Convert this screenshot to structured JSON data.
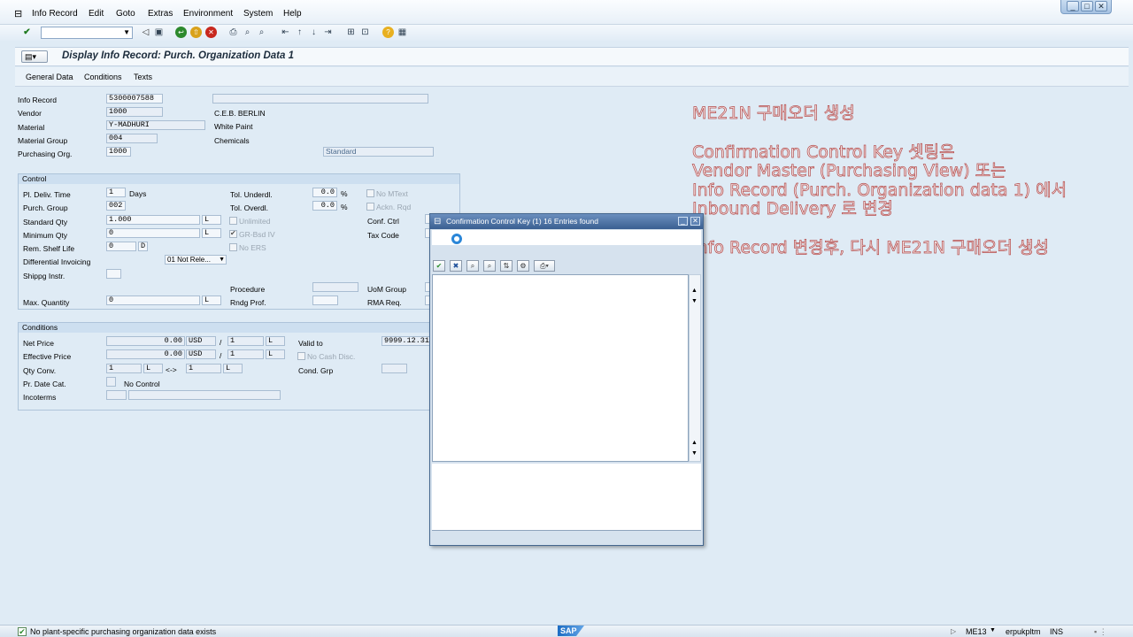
{
  "menu": {
    "items": [
      "Info Record",
      "Edit",
      "Goto",
      "Extras",
      "Environment",
      "System",
      "Help"
    ]
  },
  "window_controls": {
    "minimize": "_",
    "maximize": "□",
    "close": "✕"
  },
  "toolbar": {
    "command_field_value": ""
  },
  "screen": {
    "title": "Display Info Record: Purch. Organization Data 1",
    "tabs": [
      "General Data",
      "Conditions",
      "Texts"
    ]
  },
  "header_fields": {
    "info_record_label": "Info Record",
    "info_record_value": "5300007588",
    "vendor_label": "Vendor",
    "vendor_value": "1000",
    "vendor_name": "C.E.B. BERLIN",
    "material_label": "Material",
    "material_value": "Y-MADHURI",
    "material_name": "White Paint",
    "material_group_label": "Material Group",
    "material_group_value": "004",
    "material_group_name": "Chemicals",
    "purch_org_label": "Purchasing Org.",
    "purch_org_value": "1000",
    "info_category_value": "Standard"
  },
  "control": {
    "title": "Control",
    "pl_deliv_time_label": "Pl. Deliv. Time",
    "pl_deliv_time_value": "1",
    "days_label": "Days",
    "purch_group_label": "Purch. Group",
    "purch_group_value": "002",
    "standard_qty_label": "Standard Qty",
    "standard_qty_value": "1.000",
    "standard_qty_unit": "L",
    "minimum_qty_label": "Minimum Qty",
    "minimum_qty_value": "0",
    "minimum_qty_unit": "L",
    "rem_shelf_life_label": "Rem. Shelf Life",
    "rem_shelf_life_value": "0",
    "rem_shelf_life_unit": "D",
    "diff_invoicing_label": "Differential Invoicing",
    "diff_invoicing_value": "01 Not Rele...",
    "shippg_instr_label": "Shippg Instr.",
    "tol_underdl_label": "Tol. Underdl.",
    "tol_underdl_value": "0.0",
    "tol_overdl_label": "Tol. Overdl.",
    "tol_overdl_value": "0.0",
    "percent": "%",
    "unlimited_label": "Unlimited",
    "gr_bsd_iv_label": "GR-Bsd IV",
    "no_ers_label": "No ERS",
    "no_mtext_label": "No MText",
    "ackn_rqd_label": "Ackn. Rqd",
    "conf_ctrl_label": "Conf. Ctrl",
    "tax_code_label": "Tax Code",
    "procedure_label": "Procedure",
    "rndg_prof_label": "Rndg Prof.",
    "uom_group_label": "UoM Group",
    "rma_req_label": "RMA Req.",
    "max_qty_label": "Max. Quantity",
    "max_qty_value": "0",
    "max_qty_unit": "L"
  },
  "conditions": {
    "title": "Conditions",
    "net_price_label": "Net Price",
    "net_price_value": "0.00",
    "net_price_currency": "USD",
    "net_price_per": "1",
    "net_price_unit": "L",
    "eff_price_label": "Effective Price",
    "eff_price_value": "0.00",
    "eff_price_currency": "USD",
    "eff_price_per": "1",
    "eff_price_unit": "L",
    "qty_conv_label": "Qty Conv.",
    "qty_conv_left": "1",
    "qty_conv_left_unit": "L",
    "qty_conv_arrow": "<->",
    "qty_conv_right": "1",
    "qty_conv_right_unit": "L",
    "pr_date_cat_label": "Pr. Date Cat.",
    "pr_date_cat_text": "No Control",
    "incoterms_label": "Incoterms",
    "valid_to_label": "Valid to",
    "valid_to_value": "9999.12.31",
    "no_cash_disc_label": "No Cash Disc.",
    "cond_grp_label": "Cond. Grp",
    "slash": "/"
  },
  "dialog": {
    "title": "Confirmation Control Key (1)   16 Entries found"
  },
  "overlay_text": {
    "line1": "ME21N 구매오더 생성",
    "line2": "Confirmation Control Key 셋팅은",
    "line3": "Vendor Master (Purchasing View) 또는",
    "line4": "Info Record (Purch. Organization data 1) 에서",
    "line5": "Inbound Delivery 로 변경",
    "line6": "Info Record 변경후, 다시 ME21N 구매오더 생성"
  },
  "status": {
    "message": "No plant-specific purchasing organization data exists",
    "transaction": "ME13",
    "server": "erpukpltm",
    "mode": "INS"
  },
  "colors": {
    "background": "#dfebf5",
    "overlay_text_outline": "#b34c4c",
    "dialog_title": "#3a5f91"
  }
}
